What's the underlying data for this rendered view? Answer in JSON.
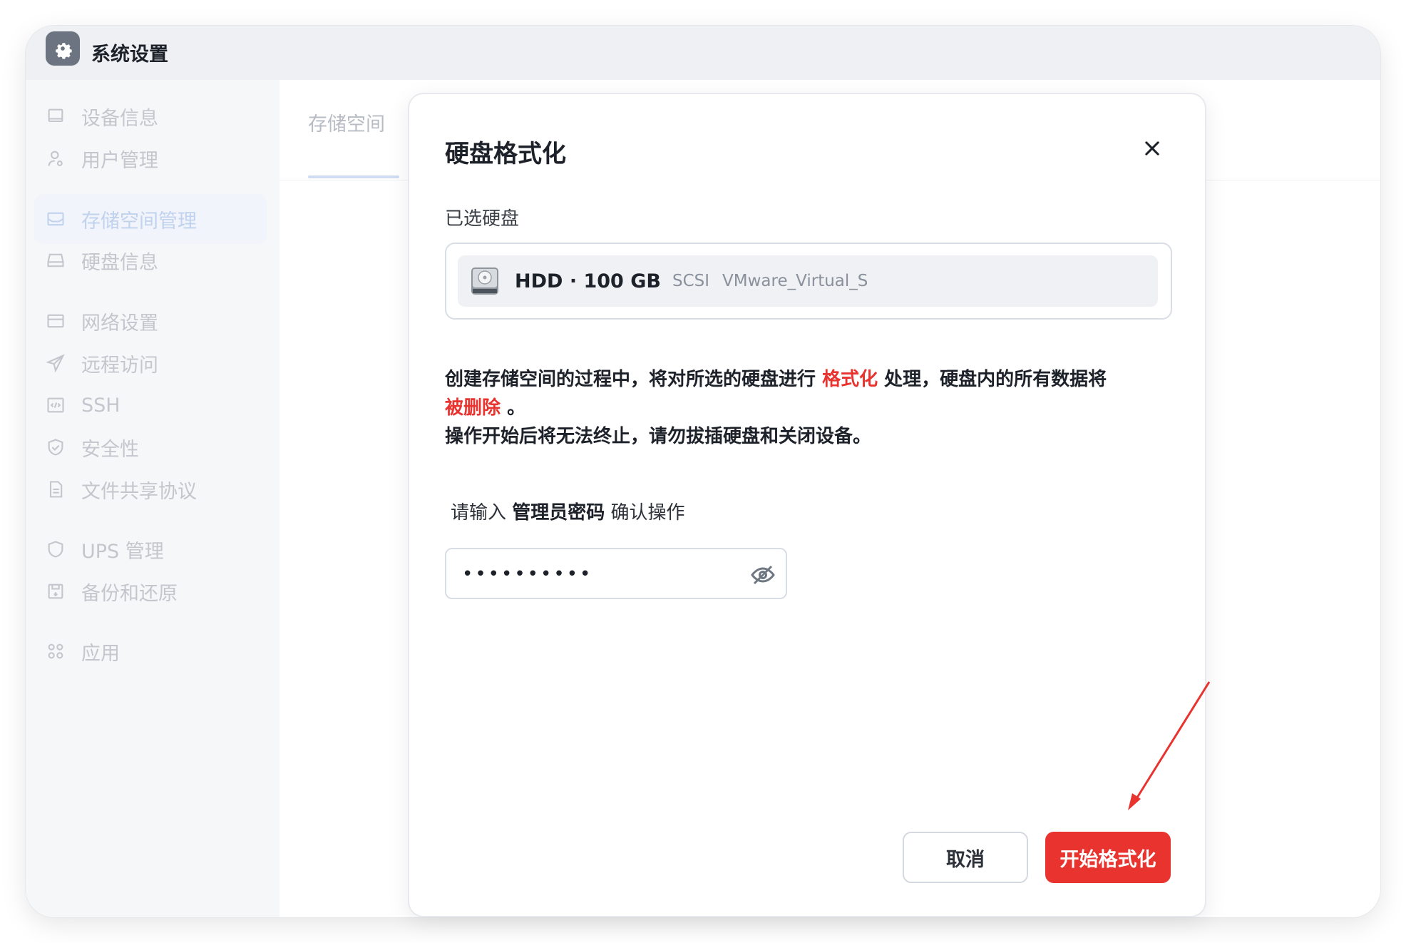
{
  "app": {
    "title": "系统设置",
    "icon": "gear-icon"
  },
  "sidebar": {
    "items": [
      {
        "label": "设备信息",
        "icon": "monitor-icon",
        "active": false
      },
      {
        "label": "用户管理",
        "icon": "user-icon",
        "active": false
      },
      {
        "label": "存储空间管理",
        "icon": "storage-icon",
        "active": true
      },
      {
        "label": "硬盘信息",
        "icon": "drive-icon",
        "active": false
      },
      {
        "label": "网络设置",
        "icon": "network-icon",
        "active": false
      },
      {
        "label": "远程访问",
        "icon": "send-icon",
        "active": false
      },
      {
        "label": "SSH",
        "icon": "code-icon",
        "active": false
      },
      {
        "label": "安全性",
        "icon": "shield-check-icon",
        "active": false
      },
      {
        "label": "文件共享协议",
        "icon": "file-icon",
        "active": false
      },
      {
        "label": "UPS 管理",
        "icon": "shield-icon",
        "active": false
      },
      {
        "label": "备份和还原",
        "icon": "save-icon",
        "active": false
      },
      {
        "label": "应用",
        "icon": "apps-icon",
        "active": false
      }
    ]
  },
  "content": {
    "tab": "存储空间"
  },
  "modal": {
    "title": "硬盘格式化",
    "selected_label": "已选硬盘",
    "disk": {
      "name": "HDD · 100 GB",
      "interface": "SCSI",
      "model": "VMware_Virtual_S"
    },
    "warning": {
      "part1": "创建存储空间的过程中，将对所选的硬盘进行 ",
      "highlight1": "格式化",
      "part2": " 处理，硬盘内的所有数据将",
      "highlight2": "被删除",
      "part3": " 。",
      "line2": "操作开始后将无法终止，请勿拔插硬盘和关闭设备。"
    },
    "password": {
      "prefix": "请输入 ",
      "emphasis": "管理员密码",
      "suffix": " 确认操作",
      "value": "••••••••••"
    },
    "buttons": {
      "cancel": "取消",
      "confirm": "开始格式化"
    }
  },
  "colors": {
    "accent_red": "#e8332f",
    "arrow": "#e8332f"
  }
}
